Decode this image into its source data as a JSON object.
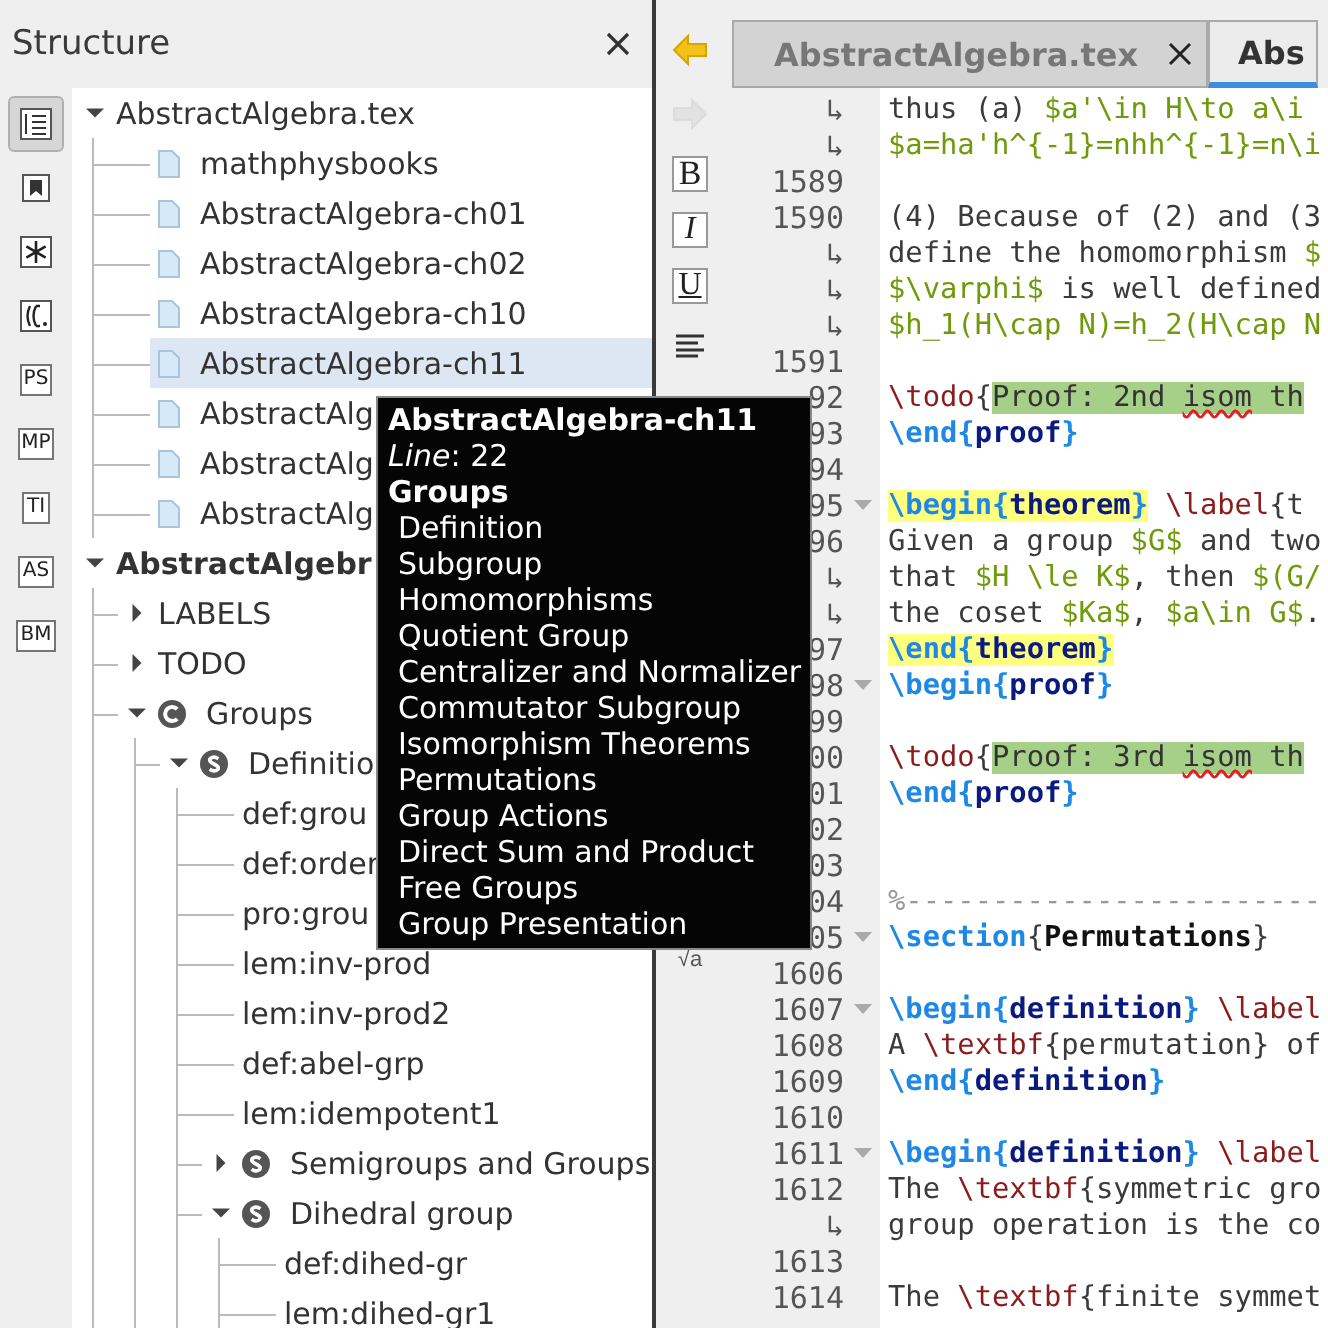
{
  "structure_panel": {
    "title": "Structure",
    "tools": [
      {
        "selected": true
      },
      {
        "selected": false
      },
      {
        "selected": false
      },
      {
        "selected": false
      },
      {
        "label": "PS",
        "selected": false
      },
      {
        "label": "MP",
        "selected": false
      },
      {
        "label": "TI",
        "selected": false
      },
      {
        "label": "AS",
        "selected": false
      },
      {
        "label": "BM",
        "selected": false
      }
    ],
    "tree": [
      {
        "label": "AbstractAlgebra.tex",
        "kind": "list",
        "selected": false,
        "expanded": true,
        "children": [
          {
            "label": "mathphysbooks",
            "kind": "file",
            "selected": false
          },
          {
            "label": "AbstractAlgebra-ch01",
            "kind": "file",
            "selected": false
          },
          {
            "label": "AbstractAlgebra-ch02",
            "kind": "file",
            "selected": false
          },
          {
            "label": "AbstractAlgebra-ch10",
            "kind": "file",
            "selected": false
          },
          {
            "label": "AbstractAlgebra-ch11",
            "kind": "file",
            "selected": true
          },
          {
            "label": "AbstractAlg",
            "kind": "file",
            "selected": false
          },
          {
            "label": "AbstractAlg",
            "kind": "file",
            "selected": false
          },
          {
            "label": "AbstractAlg",
            "kind": "file",
            "selected": false
          }
        ]
      },
      {
        "label": "AbstractAlgebr",
        "kind": "document",
        "selected": false,
        "expanded": true,
        "children": [
          {
            "label": "LABELS",
            "selected": false,
            "expanded": false
          },
          {
            "label": "TODO",
            "selected": false,
            "expanded": false
          },
          {
            "label": "Groups",
            "kind": "chapter",
            "selected": false,
            "expanded": true,
            "children": [
              {
                "label": "Definitio",
                "kind": "section",
                "selected": false,
                "expanded": true,
                "children": [
                  {
                    "label": "def:grou",
                    "selected": false
                  },
                  {
                    "label": "def:order",
                    "selected": false
                  },
                  {
                    "label": "pro:grou",
                    "selected": false
                  },
                  {
                    "label": "lem:inv-prod",
                    "selected": false
                  },
                  {
                    "label": "lem:inv-prod2",
                    "selected": false
                  },
                  {
                    "label": "def:abel-grp",
                    "selected": false
                  },
                  {
                    "label": "lem:idempotent1",
                    "selected": false
                  },
                  {
                    "label": "Semigroups and Groups",
                    "kind": "section",
                    "selected": false,
                    "expanded": false
                  },
                  {
                    "label": "Dihedral group",
                    "kind": "section",
                    "selected": false,
                    "expanded": true,
                    "children": [
                      {
                        "label": "def:dihed-gr",
                        "selected": false
                      },
                      {
                        "label": "lem:dihed-gr1",
                        "selected": false
                      }
                    ]
                  }
                ]
              }
            ]
          }
        ]
      }
    ]
  },
  "editor": {
    "tools": [
      {
        "kind": "back",
        "disabled": false
      },
      {
        "kind": "forward",
        "disabled": true
      },
      {
        "kind": "bold",
        "label": "B"
      },
      {
        "kind": "italic",
        "label": "I"
      },
      {
        "kind": "underline",
        "label": "U"
      },
      {
        "kind": "align"
      },
      {
        "kind": "text",
        "label": "√a"
      }
    ],
    "tabs": [
      {
        "label": "AbstractAlgebra.tex",
        "selected": false,
        "closable": true
      },
      {
        "label": "Abs",
        "selected": true,
        "closable": false
      }
    ],
    "lines": [
      {
        "number": "↳",
        "fold": false,
        "segments": [
          {
            "kind": "text",
            "text": "thus (a) "
          },
          {
            "kind": "math",
            "text": "$a'\\in H\\to a\\i"
          }
        ]
      },
      {
        "number": "↳",
        "fold": false,
        "segments": [
          {
            "kind": "math",
            "text": "$a=ha'h^{-1}=nhh^{-1}=n\\i"
          }
        ]
      },
      {
        "number": "1589",
        "fold": false
      },
      {
        "number": "1590",
        "fold": false,
        "segments": [
          {
            "kind": "text",
            "text": "(4) Because of (2) and (3"
          }
        ]
      },
      {
        "number": "↳",
        "fold": false,
        "segments": [
          {
            "kind": "text",
            "text": "define the homomorphism "
          },
          {
            "kind": "math",
            "text": "$"
          }
        ]
      },
      {
        "number": "↳",
        "fold": false,
        "segments": [
          {
            "kind": "math",
            "text": "$\\varphi$"
          },
          {
            "kind": "text",
            "text": " is well defined"
          }
        ]
      },
      {
        "number": "↳",
        "fold": false,
        "segments": [
          {
            "kind": "math",
            "text": "$h_1(H\\cap N)=h_2(H\\cap N"
          }
        ]
      },
      {
        "number": "1591",
        "fold": false
      },
      {
        "number": "92",
        "fold": false,
        "segments": [
          {
            "kind": "command",
            "text": "\\todo"
          },
          {
            "kind": "text",
            "text": "{"
          },
          {
            "kind": "note",
            "text": "Proof: 2nd "
          },
          {
            "kind": "note-misspelled",
            "text": "isom"
          },
          {
            "kind": "note",
            "text": " th"
          }
        ]
      },
      {
        "number": "93",
        "fold": false,
        "segments": [
          {
            "kind": "keyword",
            "text": "\\end{"
          },
          {
            "kind": "name",
            "text": "proof"
          },
          {
            "kind": "keyword",
            "text": "}"
          }
        ]
      },
      {
        "number": "94",
        "fold": false
      },
      {
        "number": "95",
        "fold": true,
        "segments": [
          {
            "kind": "keyword-marked",
            "text": "\\begin{"
          },
          {
            "kind": "name-marked",
            "text": "theorem"
          },
          {
            "kind": "keyword-marked",
            "text": "}"
          },
          {
            "kind": "command",
            "text": " \\label"
          },
          {
            "kind": "text",
            "text": "{t"
          }
        ]
      },
      {
        "number": "96",
        "fold": false,
        "segments": [
          {
            "kind": "text",
            "text": "Given a group "
          },
          {
            "kind": "math",
            "text": "$G$"
          },
          {
            "kind": "text",
            "text": " and two"
          }
        ]
      },
      {
        "number": "↳",
        "fold": false,
        "segments": [
          {
            "kind": "text",
            "text": "that "
          },
          {
            "kind": "math",
            "text": "$H \\le K$"
          },
          {
            "kind": "text",
            "text": ", then "
          },
          {
            "kind": "math",
            "text": "$(G/"
          }
        ]
      },
      {
        "number": "↳",
        "fold": false,
        "segments": [
          {
            "kind": "text",
            "text": "the coset "
          },
          {
            "kind": "math",
            "text": "$Ka$"
          },
          {
            "kind": "text",
            "text": ", "
          },
          {
            "kind": "math",
            "text": "$a\\in G$"
          },
          {
            "kind": "text",
            "text": "."
          }
        ]
      },
      {
        "number": "97",
        "fold": false,
        "segments": [
          {
            "kind": "keyword-marked",
            "text": "\\end{"
          },
          {
            "kind": "name-marked",
            "text": "theorem"
          },
          {
            "kind": "keyword-marked",
            "text": "}"
          }
        ]
      },
      {
        "number": "98",
        "fold": true,
        "segments": [
          {
            "kind": "keyword",
            "text": "\\begin{"
          },
          {
            "kind": "name",
            "text": "proof"
          },
          {
            "kind": "keyword",
            "text": "}"
          }
        ]
      },
      {
        "number": "99",
        "fold": false
      },
      {
        "number": "00",
        "fold": false,
        "segments": [
          {
            "kind": "command",
            "text": "\\todo"
          },
          {
            "kind": "text",
            "text": "{"
          },
          {
            "kind": "note",
            "text": "Proof: 3rd "
          },
          {
            "kind": "note-misspelled",
            "text": "isom"
          },
          {
            "kind": "note",
            "text": " th"
          }
        ]
      },
      {
        "number": "01",
        "fold": false,
        "segments": [
          {
            "kind": "keyword",
            "text": "\\end{"
          },
          {
            "kind": "name",
            "text": "proof"
          },
          {
            "kind": "keyword",
            "text": "}"
          }
        ]
      },
      {
        "number": "02",
        "fold": false
      },
      {
        "number": "03",
        "fold": false
      },
      {
        "number": "04",
        "fold": false,
        "segments": [
          {
            "kind": "comment",
            "text": "%------------------------"
          }
        ]
      },
      {
        "number": "05",
        "fold": true,
        "segments": [
          {
            "kind": "keyword",
            "text": "\\section"
          },
          {
            "kind": "text",
            "text": "{"
          },
          {
            "kind": "heading",
            "text": "Permutations"
          },
          {
            "kind": "text",
            "text": "}"
          }
        ]
      },
      {
        "number": "1606",
        "fold": false
      },
      {
        "number": "1607",
        "fold": true,
        "segments": [
          {
            "kind": "keyword",
            "text": "\\begin{"
          },
          {
            "kind": "name",
            "text": "definition"
          },
          {
            "kind": "keyword",
            "text": "}"
          },
          {
            "kind": "command",
            "text": " \\label"
          }
        ]
      },
      {
        "number": "1608",
        "fold": false,
        "segments": [
          {
            "kind": "text",
            "text": "A "
          },
          {
            "kind": "command",
            "text": "\\textbf"
          },
          {
            "kind": "text",
            "text": "{permutation} of"
          }
        ]
      },
      {
        "number": "1609",
        "fold": false,
        "segments": [
          {
            "kind": "keyword",
            "text": "\\end{"
          },
          {
            "kind": "name",
            "text": "definition"
          },
          {
            "kind": "keyword",
            "text": "}"
          }
        ]
      },
      {
        "number": "1610",
        "fold": false
      },
      {
        "number": "1611",
        "fold": true,
        "segments": [
          {
            "kind": "keyword",
            "text": "\\begin{"
          },
          {
            "kind": "name",
            "text": "definition"
          },
          {
            "kind": "keyword",
            "text": "}"
          },
          {
            "kind": "command",
            "text": " \\label"
          }
        ]
      },
      {
        "number": "1612",
        "fold": false,
        "segments": [
          {
            "kind": "text",
            "text": "The "
          },
          {
            "kind": "command",
            "text": "\\textbf"
          },
          {
            "kind": "text",
            "text": "{symmetric gro"
          }
        ]
      },
      {
        "number": "↳",
        "fold": false,
        "segments": [
          {
            "kind": "text",
            "text": "group operation is the co"
          }
        ]
      },
      {
        "number": "1613",
        "fold": false
      },
      {
        "number": "1614",
        "fold": false,
        "segments": [
          {
            "kind": "text",
            "text": "The "
          },
          {
            "kind": "command",
            "text": "\\textbf"
          },
          {
            "kind": "text",
            "text": "{finite symmet"
          }
        ]
      }
    ]
  },
  "tooltip": {
    "title": "AbstractAlgebra-ch11",
    "line": "*Line*: 22",
    "heading": "Groups",
    "items": [
      "Definition",
      "Subgroup",
      "Homomorphisms",
      "Quotient Group",
      "Centralizer and Normalizer",
      "Commutator Subgroup",
      "Isomorphism Theorems",
      "Permutations",
      "Group Actions",
      "Direct Sum and Product",
      "Free Groups",
      "Group Presentation"
    ]
  }
}
